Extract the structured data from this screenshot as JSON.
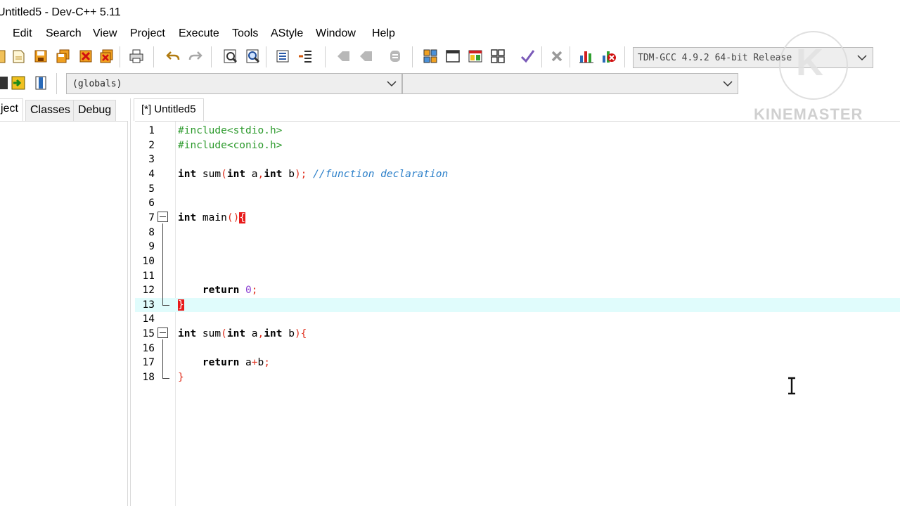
{
  "window": {
    "title": "Untitled5 - Dev-C++ 5.11"
  },
  "menu": [
    "Edit",
    "Search",
    "View",
    "Project",
    "Execute",
    "Tools",
    "AStyle",
    "Window",
    "Help"
  ],
  "toolbar": {
    "compiler_select": "TDM-GCC 4.9.2 64-bit Release",
    "scope_select": "(globals)",
    "function_select": ""
  },
  "left_panel": {
    "tabs": [
      "ject",
      "Classes",
      "Debug"
    ]
  },
  "editor": {
    "tab_label": "[*] Untitled5",
    "current_line": 13,
    "lines": [
      {
        "n": "1",
        "tokens": [
          [
            "pre",
            "#include<stdio.h>"
          ]
        ]
      },
      {
        "n": "2",
        "tokens": [
          [
            "pre",
            "#include<conio.h>"
          ]
        ]
      },
      {
        "n": "3",
        "tokens": []
      },
      {
        "n": "4",
        "tokens": [
          [
            "kw",
            "int"
          ],
          [
            "txt",
            " sum"
          ],
          [
            "sym",
            "("
          ],
          [
            "kw",
            "int"
          ],
          [
            "txt",
            " a"
          ],
          [
            "sym",
            ","
          ],
          [
            "kw",
            "int"
          ],
          [
            "txt",
            " b"
          ],
          [
            "sym",
            ");"
          ],
          [
            "txt",
            " "
          ],
          [
            "com",
            "//function declaration"
          ]
        ]
      },
      {
        "n": "5",
        "tokens": []
      },
      {
        "n": "6",
        "tokens": []
      },
      {
        "n": "7",
        "tokens": [
          [
            "kw",
            "int"
          ],
          [
            "txt",
            " main"
          ],
          [
            "sym",
            "()"
          ],
          [
            "hl",
            "{"
          ]
        ]
      },
      {
        "n": "8",
        "tokens": []
      },
      {
        "n": "9",
        "tokens": []
      },
      {
        "n": "10",
        "tokens": []
      },
      {
        "n": "11",
        "tokens": []
      },
      {
        "n": "12",
        "tokens": [
          [
            "txt",
            "    "
          ],
          [
            "kw",
            "return"
          ],
          [
            "txt",
            " "
          ],
          [
            "num",
            "0"
          ],
          [
            "sym",
            ";"
          ]
        ]
      },
      {
        "n": "13",
        "tokens": [
          [
            "hl",
            "}"
          ]
        ]
      },
      {
        "n": "14",
        "tokens": []
      },
      {
        "n": "15",
        "tokens": [
          [
            "kw",
            "int"
          ],
          [
            "txt",
            " sum"
          ],
          [
            "sym",
            "("
          ],
          [
            "kw",
            "int"
          ],
          [
            "txt",
            " a"
          ],
          [
            "sym",
            ","
          ],
          [
            "kw",
            "int"
          ],
          [
            "txt",
            " b"
          ],
          [
            "sym",
            "){"
          ]
        ]
      },
      {
        "n": "16",
        "tokens": []
      },
      {
        "n": "17",
        "tokens": [
          [
            "txt",
            "    "
          ],
          [
            "kw",
            "return"
          ],
          [
            "txt",
            " a"
          ],
          [
            "sym",
            "+"
          ],
          [
            "txt",
            "b"
          ],
          [
            "sym",
            ";"
          ]
        ]
      },
      {
        "n": "18",
        "tokens": [
          [
            "sym",
            "}"
          ]
        ]
      }
    ]
  },
  "watermark": {
    "text": "KINEMASTER",
    "logo": "K"
  },
  "colors": {
    "preprocessor": "#2c9a2c",
    "symbol": "#e0301e",
    "number": "#8a3fd1",
    "comment": "#2b7fc9",
    "current_line": "#e0fcfc",
    "brace_highlight": "#e81a1a"
  }
}
